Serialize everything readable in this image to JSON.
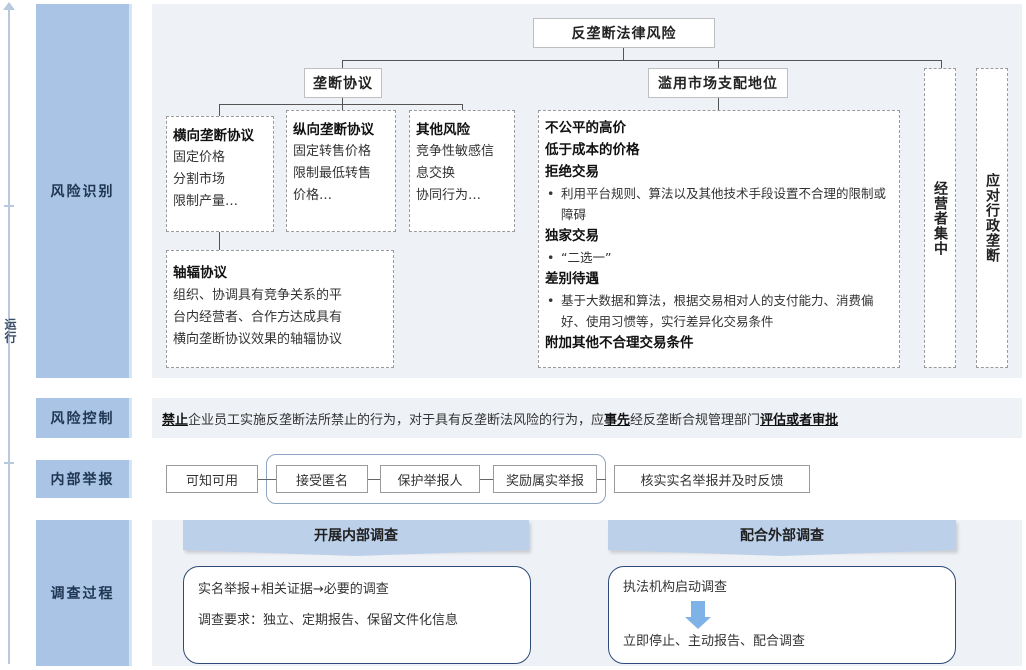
{
  "side_label": "运行",
  "sections": {
    "risk_identify": "风险识别",
    "risk_control": "风险控制",
    "internal_report": "内部举报",
    "investigation": "调查过程"
  },
  "tree": {
    "root": "反垄断法律风险",
    "monopoly_agreement": {
      "title": "垄断协议",
      "horizontal": {
        "title": "横向垄断协议",
        "items": [
          "固定价格",
          "分割市场",
          "限制产量…"
        ]
      },
      "vertical": {
        "title": "纵向垄断协议",
        "items": [
          "固定转售价格",
          "限制最低转售",
          "价格…"
        ]
      },
      "other": {
        "title": "其他风险",
        "items": [
          "竞争性敏感信",
          "息交换",
          "协同行为…"
        ]
      },
      "hub_spoke": {
        "title": "轴辐协议",
        "items": [
          "组织、协调具有竞争关系的平",
          "台内经营者、合作方达成具有",
          "横向垄断协议效果的轴辐协议"
        ]
      }
    },
    "abuse": {
      "title": "滥用市场支配地位",
      "items": [
        {
          "type": "bold",
          "text": "不公平的高价"
        },
        {
          "type": "bold",
          "text": "低于成本的价格"
        },
        {
          "type": "bold",
          "text": "拒绝交易"
        },
        {
          "type": "bullet",
          "text": "利用平台规则、算法以及其他技术手段设置不合理的限制或障碍"
        },
        {
          "type": "bold",
          "text": "独家交易"
        },
        {
          "type": "bullet",
          "text": "“二选一”"
        },
        {
          "type": "bold",
          "text": "差别待遇"
        },
        {
          "type": "bullet",
          "text": "基于大数据和算法，根据交易相对人的支付能力、消费偏好、使用习惯等，实行差异化交易条件"
        },
        {
          "type": "bold",
          "text": "附加其他不合理交易条件"
        }
      ]
    },
    "concentration": "经营者集中",
    "admin_monopoly": "应对行政垄断"
  },
  "risk_control": {
    "w1": "禁止",
    "t1": "企业员工实施反垄断法所禁止的行为，对于具有反垄断法风险的行为，应",
    "w2": "事先",
    "t2": "经反垄断合规管理部门",
    "w3": "评估或者审批"
  },
  "report_chain": [
    "可知可用",
    "接受匿名",
    "保护举报人",
    "奖励属实举报",
    "核实实名举报并及时反馈"
  ],
  "investigation": {
    "internal": {
      "title": "开展内部调查",
      "line1": "实名举报+相关证据→必要的调查",
      "line2": "调查要求：独立、定期报告、保留文件化信息"
    },
    "external": {
      "title": "配合外部调查",
      "line1": "执法机构启动调查",
      "line2": "立即停止、主动报告、配合调查"
    }
  },
  "colors": {
    "label_bg": "#a9c4e4",
    "panel_bg": "#eef1f6",
    "banner_bg": "#bcd0ea",
    "rounded_border": "#2d4b78"
  }
}
